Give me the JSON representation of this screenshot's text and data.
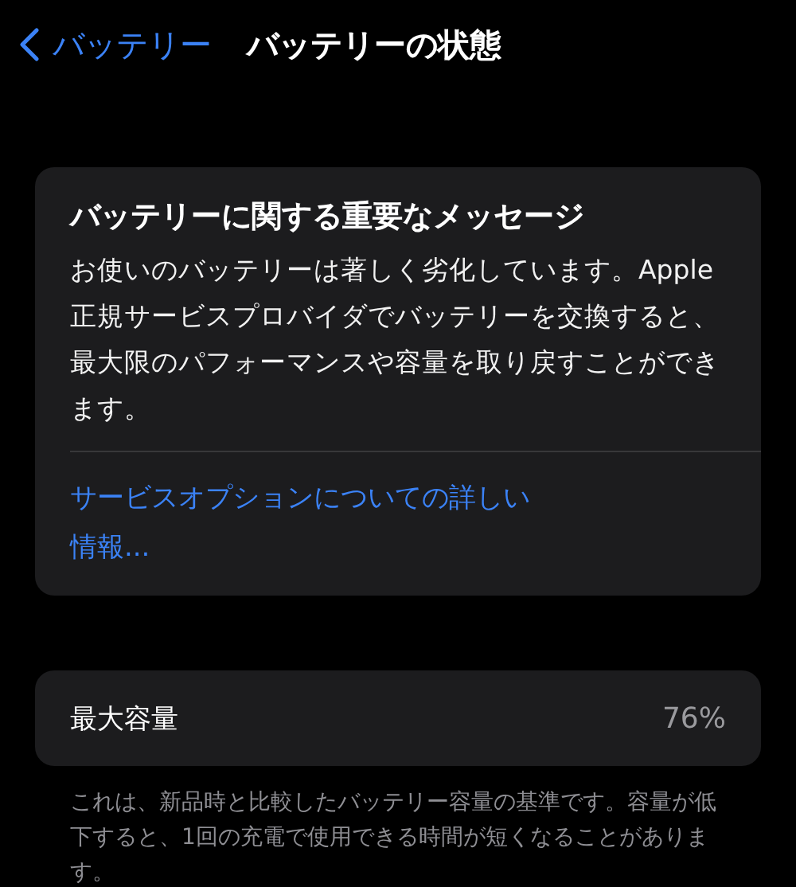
{
  "nav": {
    "back_label": "バッテリー",
    "title": "バッテリーの状態"
  },
  "message_card": {
    "title": "バッテリーに関する重要なメッセージ",
    "body": "お使いのバッテリーは著しく劣化しています。Apple 正規サービスプロバイダでバッテリーを交換すると、最大限のパフォーマンスや容量を取り戻すことができます。",
    "link": "サービスオプションについての詳しい情報..."
  },
  "capacity": {
    "label": "最大容量",
    "value": "76%",
    "footnote": "これは、新品時と比較したバッテリー容量の基準です。容量が低下すると、1回の充電で使用できる時間が短くなることがあります。"
  }
}
